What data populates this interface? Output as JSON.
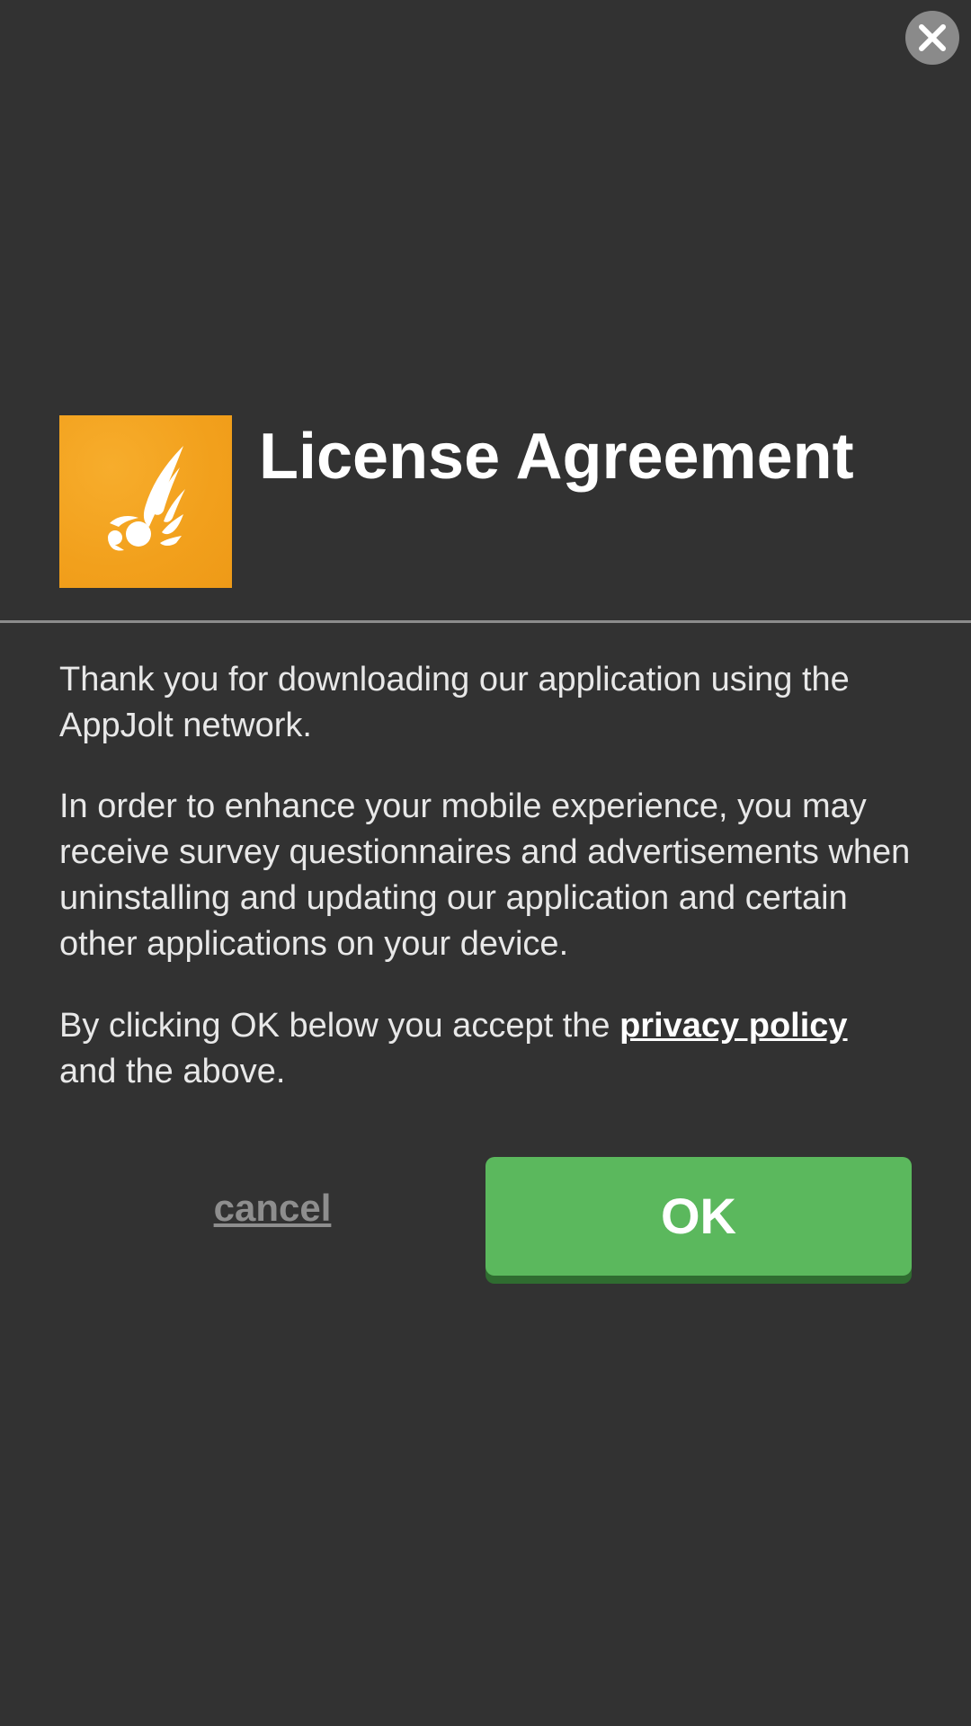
{
  "dialog": {
    "title": "License Agreement",
    "close_icon": "close-icon",
    "app_icon": "winged-helmet-logo-icon",
    "colors": {
      "background": "#323232",
      "app_icon_bg": "#f3a11e",
      "ok_button": "#5bb85d",
      "ok_button_shadow": "#2f6c30",
      "divider": "#8c8c8c",
      "cancel_text": "#8e8e8e"
    }
  },
  "body": {
    "paragraph1": "Thank you for downloading our application using the AppJolt network.",
    "paragraph2": "In order to enhance your mobile experience, you may receive survey questionnaires and advertisements when uninstalling and updating our application and certain other applications on your device.",
    "paragraph3_before": "By clicking OK below you accept the ",
    "privacy_link": "privacy policy",
    "paragraph3_after": " and the above."
  },
  "actions": {
    "cancel_label": "cancel",
    "ok_label": "OK"
  }
}
